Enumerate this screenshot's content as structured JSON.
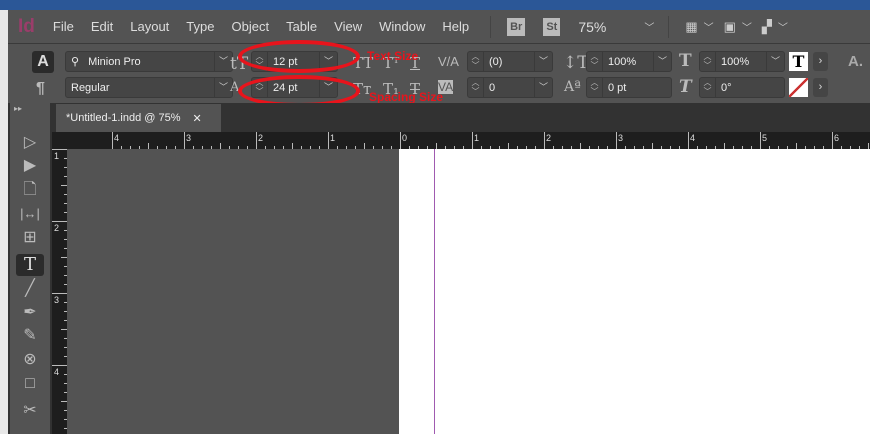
{
  "menu": {
    "logo": "Id",
    "items": [
      "File",
      "Edit",
      "Layout",
      "Type",
      "Object",
      "Table",
      "View",
      "Window",
      "Help"
    ],
    "bridge": "Br",
    "stock": "St",
    "zoom": "75%"
  },
  "control": {
    "font_family": "Minion Pro",
    "font_style": "Regular",
    "font_size": "12 pt",
    "leading": "24 pt",
    "kerning": "(0)",
    "tracking": "0",
    "vertical_scale": "100%",
    "horizontal_scale": "100%",
    "baseline_shift": "0 pt",
    "skew": "0°"
  },
  "annotations": {
    "text_size": "Text Size",
    "spacing_size": "Spacing Size",
    "color": "#e8141c"
  },
  "tab": {
    "title": "*Untitled-1.indd @ 75%",
    "close": "✕"
  },
  "ruler": {
    "h_labels": [
      "4",
      "3",
      "2",
      "1",
      "0",
      "1",
      "2",
      "3",
      "4",
      "5",
      "6"
    ],
    "v_labels": [
      "1",
      "2",
      "3",
      "4"
    ]
  }
}
